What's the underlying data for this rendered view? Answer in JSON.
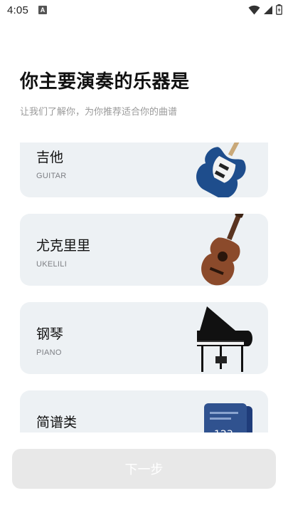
{
  "status_bar": {
    "time": "4:05",
    "notification": "A"
  },
  "header": {
    "title": "你主要演奏的乐器是",
    "subtitle": "让我们了解你，为你推荐适合你的曲谱"
  },
  "instruments": [
    {
      "name": "吉他",
      "sub": "GUITAR"
    },
    {
      "name": "尤克里里",
      "sub": "UKELILI"
    },
    {
      "name": "钢琴",
      "sub": "PIANO"
    },
    {
      "name": "简谱类",
      "sub": ""
    }
  ],
  "sheet_icon_text": "123",
  "footer": {
    "next_label": "下一步"
  },
  "colors": {
    "card_bg": "#edf1f4",
    "button_disabled": "#e8e8e8",
    "guitar_blue": "#1e4d8c",
    "ukulele_wood": "#8b4a2b",
    "piano_black": "#111111"
  }
}
